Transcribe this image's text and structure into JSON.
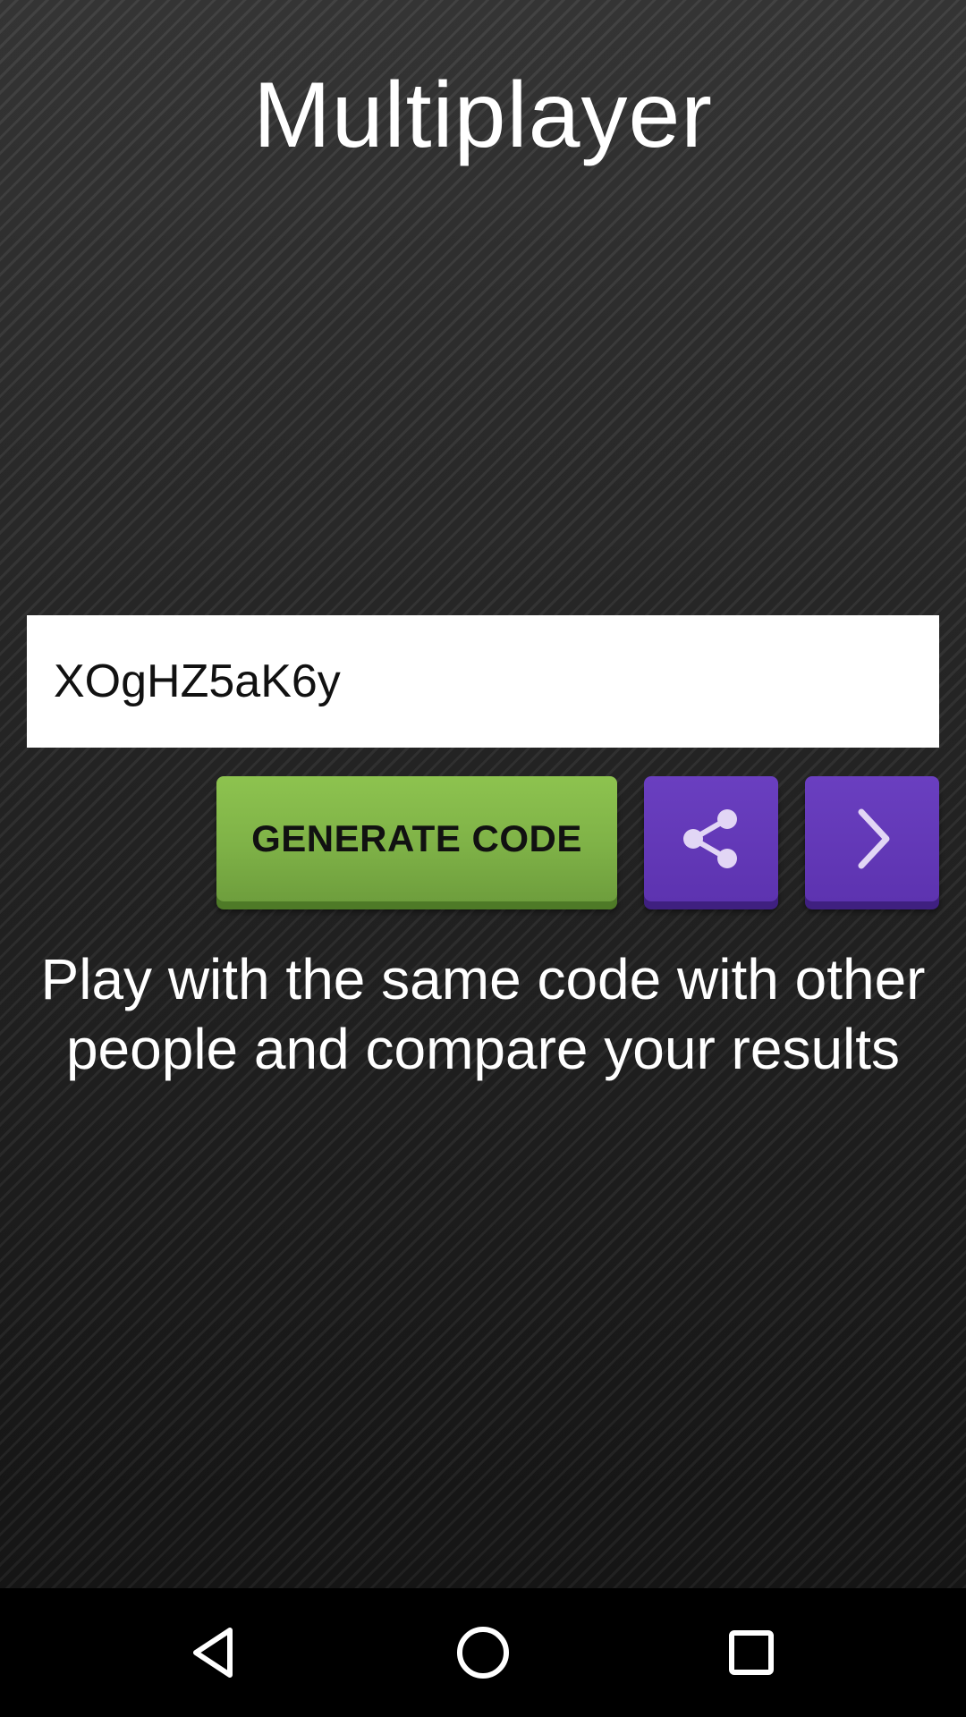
{
  "app": {
    "title": "Multiplayer"
  },
  "code_field": {
    "value": "XOgHZ5aK6y"
  },
  "buttons": {
    "generate_label": "GENERATE CODE",
    "share_icon": "share-icon",
    "next_icon": "chevron-right-icon"
  },
  "description": "Play with the same code with other people and compare your results",
  "navigation": {
    "back_icon": "back-triangle-icon",
    "home_icon": "home-circle-icon",
    "recents_icon": "recents-square-icon"
  },
  "colors": {
    "generate_button": "#7fb247",
    "purple_button": "#6a3fc0",
    "background": "#232323"
  }
}
